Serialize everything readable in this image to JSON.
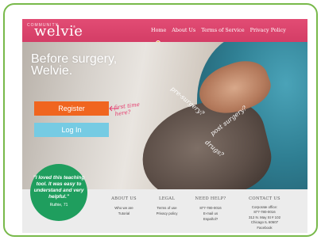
{
  "brand": {
    "small": "COMMUNITY",
    "name": "welvie",
    "tm": "®"
  },
  "nav": {
    "items": [
      "Home",
      "About Us",
      "Terms of Service",
      "Privacy Policy"
    ]
  },
  "hero": {
    "line1": "Before surgery,",
    "line2": "Welvie.",
    "first_time": [
      "first time",
      "here?"
    ],
    "handwritten": [
      "pre-surgery?",
      "post surgery?",
      "drugs?"
    ]
  },
  "buttons": {
    "register": "Register",
    "login": "Log In"
  },
  "testimonial": {
    "quote": "\"I loved this teaching tool. It was easy to understand and very helpful.\"",
    "author": "Ruthie, 71"
  },
  "footer": {
    "about": {
      "heading": "ABOUT US",
      "links": [
        "Who we are",
        "Tutorial"
      ]
    },
    "legal": {
      "heading": "LEGAL",
      "links": [
        "Terms of use",
        "Privacy policy"
      ]
    },
    "help": {
      "heading": "NEED HELP?",
      "lines": [
        "877-780-0016",
        "E-mail us",
        "Español?"
      ]
    },
    "contact": {
      "heading": "CONTACT US",
      "lines": [
        "Corporate office:",
        "877-780-0016",
        "312 N. May St # 102",
        "Chicago IL 60607",
        "Facebook"
      ]
    }
  },
  "colors": {
    "header_pink": "#d43d66",
    "register_orange": "#f0651f",
    "login_blue": "#76cbe3",
    "quote_green": "#1f9e5e",
    "frame_green": "#78b94a"
  }
}
